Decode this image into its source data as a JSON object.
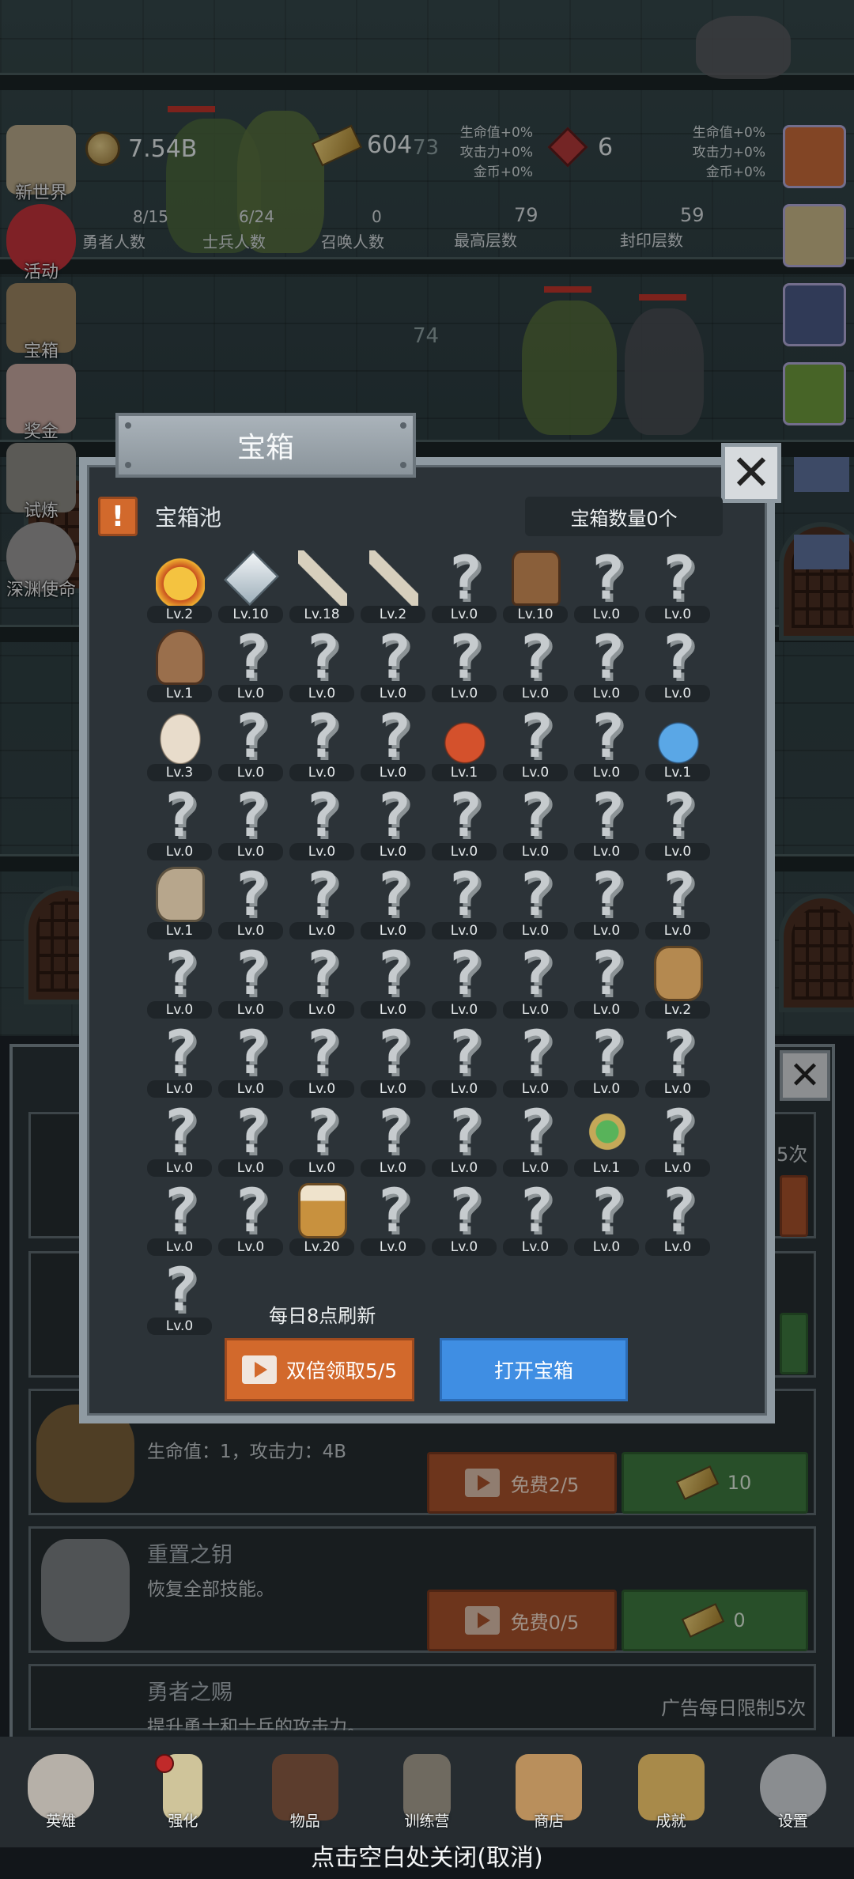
{
  "stats": {
    "gold": "7.54B",
    "gold_bars": "604",
    "gems": "6",
    "hero_count": "8/15",
    "hero_label": "勇者人数",
    "soldier_count": "6/24",
    "soldier_label": "士兵人数",
    "summon_count": "0",
    "summon_label": "召唤人数",
    "max_floor": "79",
    "max_floor_label": "最高层数",
    "seal_floor": "59",
    "seal_floor_label": "封印层数",
    "buff_left": [
      "生命值+0%",
      "攻击力+0%",
      "金币+0%"
    ],
    "buff_right": [
      "生命值+0%",
      "攻击力+0%",
      "金币+0%"
    ]
  },
  "floors": [
    "73",
    "74"
  ],
  "side_menu": [
    "新世界",
    "活动",
    "宝箱",
    "奖金",
    "试炼",
    "深渊使命"
  ],
  "modal": {
    "title": "宝箱",
    "pool_label": "宝箱池",
    "chest_count": "宝箱数量0个",
    "refresh_text": "每日8点刷新",
    "double_button": "双倍领取5/5",
    "open_button": "打开宝箱",
    "close_icon": "✕",
    "items": [
      {
        "icon": "crown",
        "level": "Lv.2"
      },
      {
        "icon": "diamond",
        "level": "Lv.10"
      },
      {
        "icon": "sword",
        "level": "Lv.18"
      },
      {
        "icon": "sword",
        "level": "Lv.2"
      },
      {
        "icon": "unknown",
        "level": "Lv.0"
      },
      {
        "icon": "armor",
        "level": "Lv.10"
      },
      {
        "icon": "unknown",
        "level": "Lv.0"
      },
      {
        "icon": "unknown",
        "level": "Lv.0"
      },
      {
        "icon": "helmet",
        "level": "Lv.1"
      },
      {
        "icon": "unknown",
        "level": "Lv.0"
      },
      {
        "icon": "unknown",
        "level": "Lv.0"
      },
      {
        "icon": "unknown",
        "level": "Lv.0"
      },
      {
        "icon": "unknown",
        "level": "Lv.0"
      },
      {
        "icon": "unknown",
        "level": "Lv.0"
      },
      {
        "icon": "unknown",
        "level": "Lv.0"
      },
      {
        "icon": "unknown",
        "level": "Lv.0"
      },
      {
        "icon": "bread",
        "level": "Lv.3"
      },
      {
        "icon": "unknown",
        "level": "Lv.0"
      },
      {
        "icon": "unknown",
        "level": "Lv.0"
      },
      {
        "icon": "unknown",
        "level": "Lv.0"
      },
      {
        "icon": "red-potion",
        "level": "Lv.1"
      },
      {
        "icon": "unknown",
        "level": "Lv.0"
      },
      {
        "icon": "unknown",
        "level": "Lv.0"
      },
      {
        "icon": "blue-potion",
        "level": "Lv.1"
      },
      {
        "icon": "unknown",
        "level": "Lv.0"
      },
      {
        "icon": "unknown",
        "level": "Lv.0"
      },
      {
        "icon": "unknown",
        "level": "Lv.0"
      },
      {
        "icon": "unknown",
        "level": "Lv.0"
      },
      {
        "icon": "unknown",
        "level": "Lv.0"
      },
      {
        "icon": "unknown",
        "level": "Lv.0"
      },
      {
        "icon": "unknown",
        "level": "Lv.0"
      },
      {
        "icon": "unknown",
        "level": "Lv.0"
      },
      {
        "icon": "boot",
        "level": "Lv.1"
      },
      {
        "icon": "unknown",
        "level": "Lv.0"
      },
      {
        "icon": "unknown",
        "level": "Lv.0"
      },
      {
        "icon": "unknown",
        "level": "Lv.0"
      },
      {
        "icon": "unknown",
        "level": "Lv.0"
      },
      {
        "icon": "unknown",
        "level": "Lv.0"
      },
      {
        "icon": "unknown",
        "level": "Lv.0"
      },
      {
        "icon": "unknown",
        "level": "Lv.0"
      },
      {
        "icon": "unknown",
        "level": "Lv.0"
      },
      {
        "icon": "unknown",
        "level": "Lv.0"
      },
      {
        "icon": "unknown",
        "level": "Lv.0"
      },
      {
        "icon": "unknown",
        "level": "Lv.0"
      },
      {
        "icon": "unknown",
        "level": "Lv.0"
      },
      {
        "icon": "unknown",
        "level": "Lv.0"
      },
      {
        "icon": "unknown",
        "level": "Lv.0"
      },
      {
        "icon": "backpack",
        "level": "Lv.2"
      },
      {
        "icon": "unknown",
        "level": "Lv.0"
      },
      {
        "icon": "unknown",
        "level": "Lv.0"
      },
      {
        "icon": "unknown",
        "level": "Lv.0"
      },
      {
        "icon": "unknown",
        "level": "Lv.0"
      },
      {
        "icon": "unknown",
        "level": "Lv.0"
      },
      {
        "icon": "unknown",
        "level": "Lv.0"
      },
      {
        "icon": "unknown",
        "level": "Lv.0"
      },
      {
        "icon": "unknown",
        "level": "Lv.0"
      },
      {
        "icon": "unknown",
        "level": "Lv.0"
      },
      {
        "icon": "unknown",
        "level": "Lv.0"
      },
      {
        "icon": "unknown",
        "level": "Lv.0"
      },
      {
        "icon": "unknown",
        "level": "Lv.0"
      },
      {
        "icon": "unknown",
        "level": "Lv.0"
      },
      {
        "icon": "unknown",
        "level": "Lv.0"
      },
      {
        "icon": "amulet",
        "level": "Lv.1"
      },
      {
        "icon": "unknown",
        "level": "Lv.0"
      },
      {
        "icon": "unknown",
        "level": "Lv.0"
      },
      {
        "icon": "unknown",
        "level": "Lv.0"
      },
      {
        "icon": "beer",
        "level": "Lv.20"
      },
      {
        "icon": "unknown",
        "level": "Lv.0"
      },
      {
        "icon": "unknown",
        "level": "Lv.0"
      },
      {
        "icon": "unknown",
        "level": "Lv.0"
      },
      {
        "icon": "unknown",
        "level": "Lv.0"
      },
      {
        "icon": "unknown",
        "level": "Lv.0"
      },
      {
        "icon": "unknown",
        "level": "Lv.0"
      }
    ]
  },
  "under_panel": {
    "limit_text_top": "5次",
    "card3_desc": "生命值：1，攻击力：4B",
    "card3_free": "免费2/5",
    "card3_cost": "10",
    "card4_title": "重置之钥",
    "card4_desc": "恢复全部技能。",
    "card4_free": "免费0/5",
    "card4_cost": "0",
    "card5_title": "勇者之赐",
    "card5_desc": "提升勇士和士兵的攻击力。",
    "card5_limit": "广告每日限制5次"
  },
  "bottom_nav": [
    "英雄",
    "强化",
    "物品",
    "训练营",
    "商店",
    "成就",
    "设置"
  ],
  "close_hint": "点击空白处关闭(取消)",
  "colors": {
    "modal_bg": "#2c3338",
    "orange": "#d2692c",
    "blue": "#3f8ee3",
    "green": "#3e7a3f"
  }
}
